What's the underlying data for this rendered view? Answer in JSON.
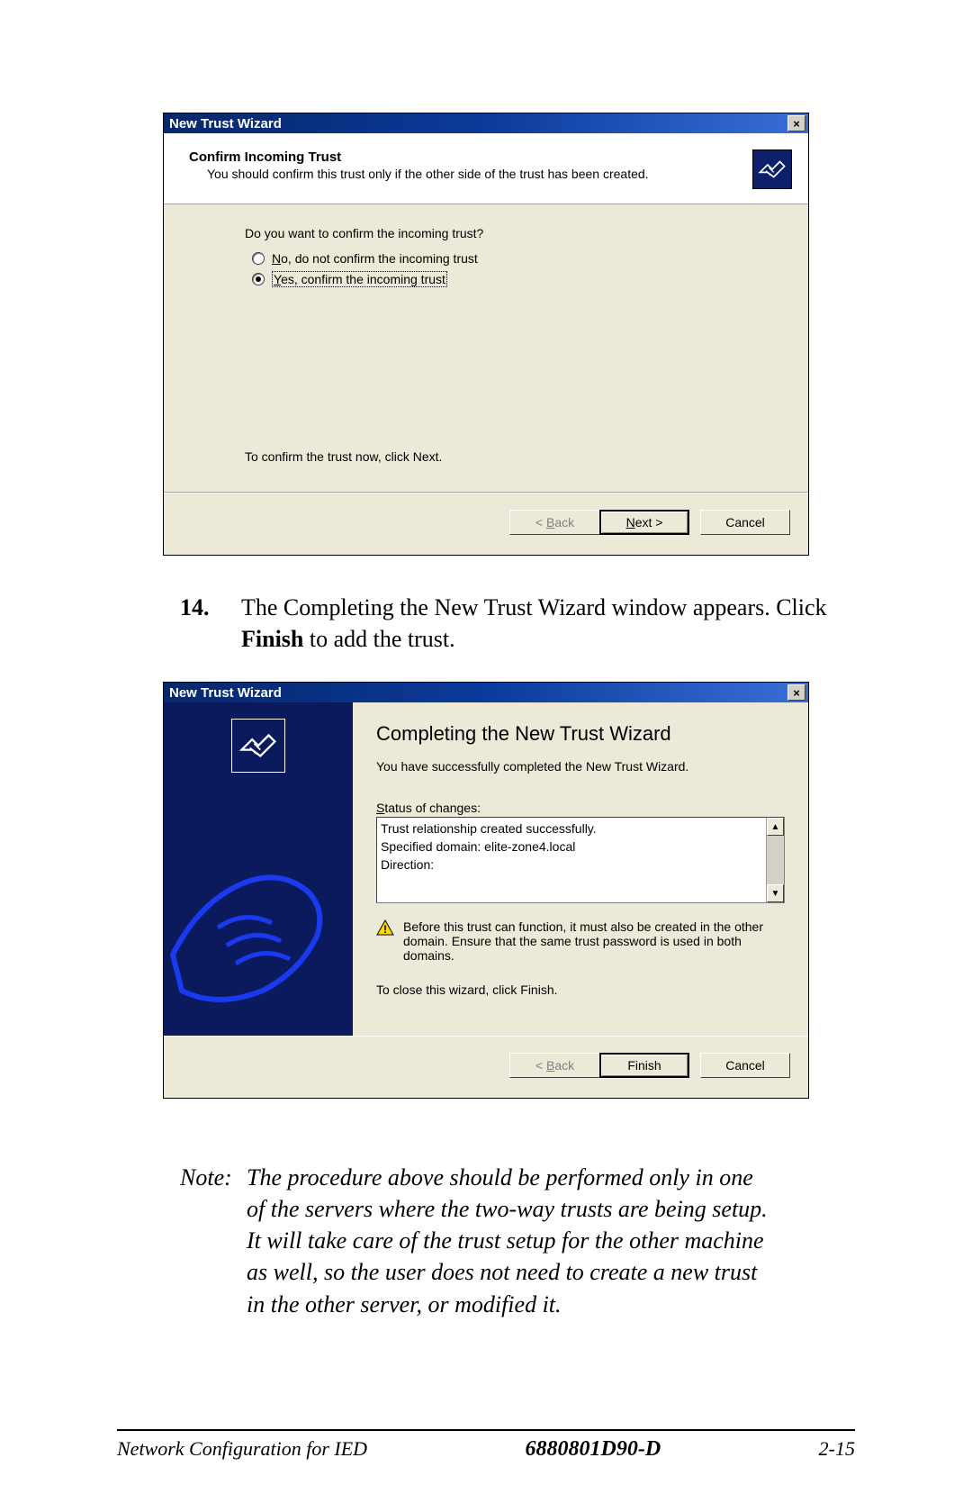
{
  "dialog1": {
    "title": "New Trust Wizard",
    "header_title": "Confirm Incoming Trust",
    "header_sub": "You should confirm this trust only if the other side of the trust has been created.",
    "question": "Do you want to confirm the incoming trust?",
    "option_no_prefix": "N",
    "option_no_rest": "o, do not confirm the incoming trust",
    "option_yes_prefix": "Y",
    "option_yes_rest": "es, confirm the incoming trust",
    "hint": "To confirm the trust now, click Next.",
    "btn_back": "< Back",
    "btn_next": "Next >",
    "btn_cancel": "Cancel"
  },
  "step14": {
    "num": "14.",
    "text_before": "The Completing the New Trust Wizard window appears. Click ",
    "bold": "Finish",
    "text_after": " to add the trust."
  },
  "dialog2": {
    "title": "New Trust Wizard",
    "content_title": "Completing the New Trust Wizard",
    "sub": "You have successfully completed the New Trust Wizard.",
    "status_label": "Status of changes:",
    "status_label_u": "S",
    "status_items": [
      "Trust relationship created successfully.",
      "Specified domain: elite-zone4.local",
      "Direction:"
    ],
    "warning": "Before this trust can function, it must also be created in the other domain. Ensure that the same trust password is used in both domains.",
    "close_hint": "To close this wizard, click Finish.",
    "btn_back": "< Back",
    "btn_finish": "Finish",
    "btn_cancel": "Cancel"
  },
  "note": {
    "label": "Note:",
    "text": "The procedure above should be performed only in one of the servers where the two-way trusts are being setup.  It will take care of the trust setup for the other machine as well, so the user does not need to create a new trust in the other server, or modified it."
  },
  "footer": {
    "left": "Network Configuration for IED",
    "center": "6880801D90-D",
    "right": "2-15"
  }
}
